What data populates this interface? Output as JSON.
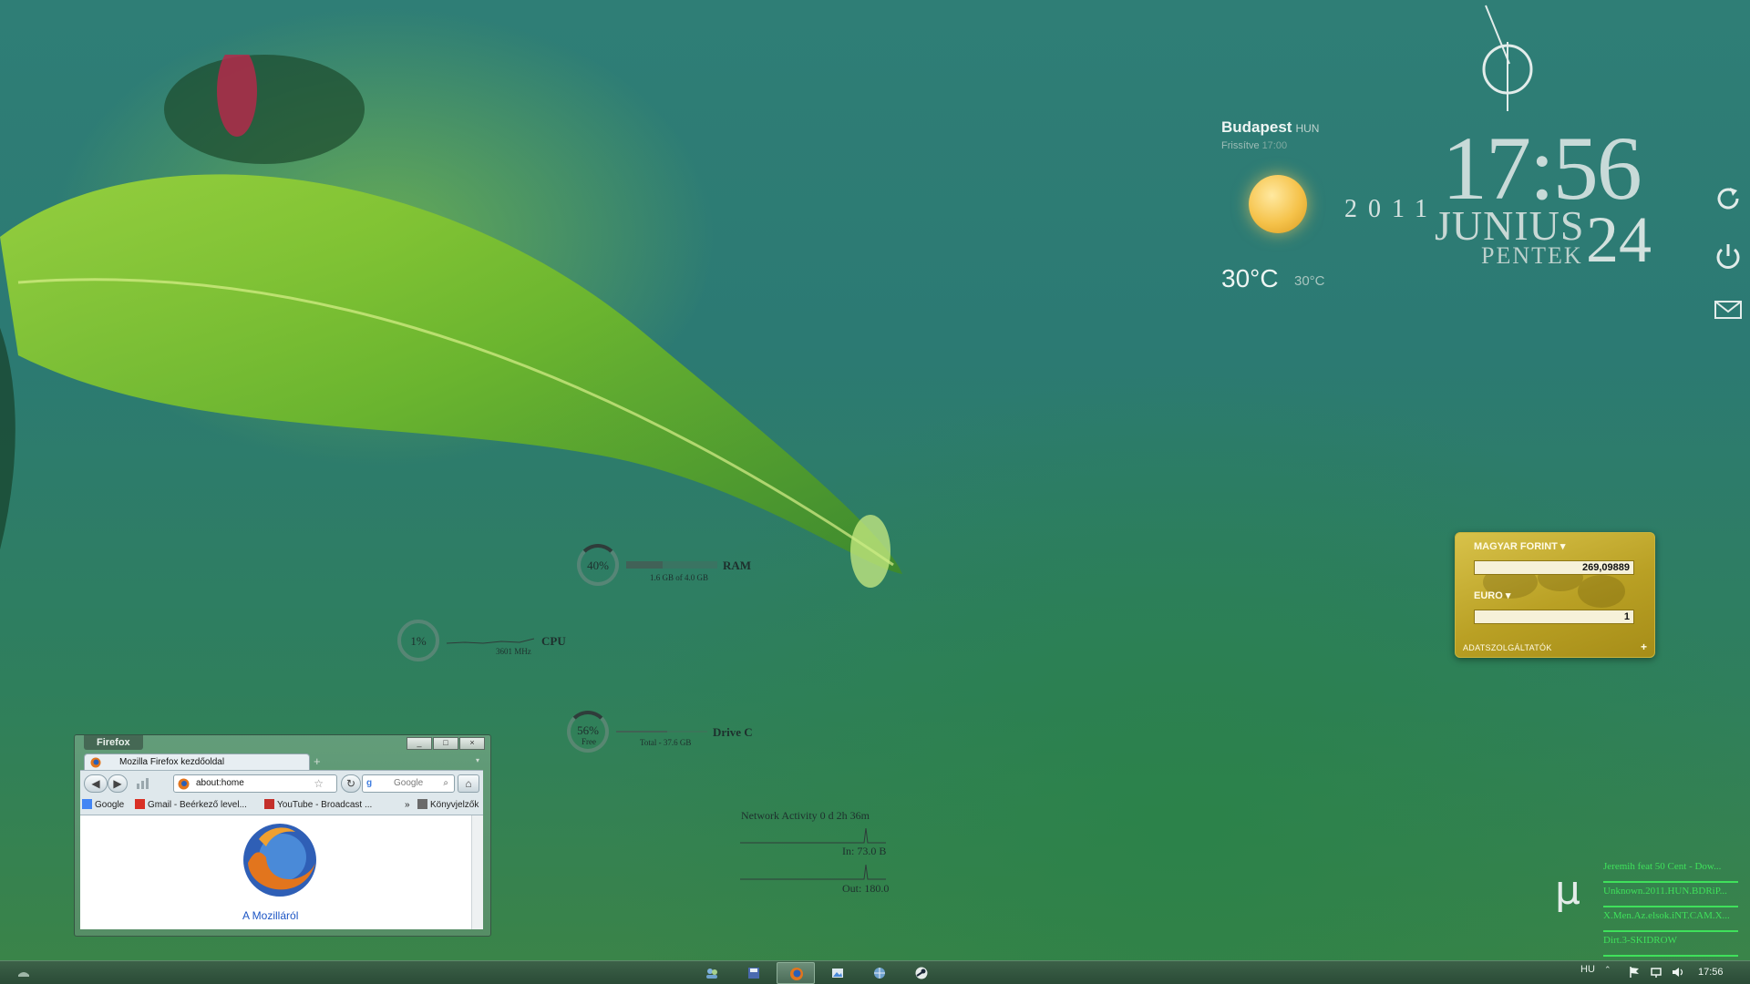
{
  "weather": {
    "city": "Budapest",
    "country": "HUN",
    "updated_label": "Frissítve",
    "updated_time": "17:00",
    "temperature": "30°C",
    "feels_like": "30°C",
    "condition_icon": "sun-icon"
  },
  "clock": {
    "time": "17:56",
    "year": "2011",
    "month": "JUNIUS",
    "day": "24",
    "weekday": "PENTEK"
  },
  "side_icons": [
    "refresh-icon",
    "power-icon",
    "mail-icon"
  ],
  "meters": {
    "ram": {
      "percent": "40%",
      "value": 0.4,
      "label": "RAM",
      "detail": "1.6 GB of 4.0 GB"
    },
    "cpu": {
      "percent": "1%",
      "value": 0.01,
      "label": "CPU",
      "detail": "3601 MHz"
    },
    "drive": {
      "percent": "56%",
      "sub": "Free",
      "value": 0.56,
      "label": "Drive C",
      "detail": "Total - 37.6 GB"
    }
  },
  "network": {
    "title": "Network Activity",
    "uptime": "0 d 2h 36m",
    "in": "In: 73.0 B",
    "out": "Out: 180.0"
  },
  "currency": {
    "from_name": "MAGYAR FORINT",
    "from_value": "269,09889",
    "to_name": "EURO",
    "to_value": "1",
    "providers": "ADATSZOLGÁLTATÓK",
    "add": "+"
  },
  "firefox": {
    "app_title": "Firefox",
    "tab_title": "Mozilla Firefox kezdőoldal",
    "new_tab": "+",
    "url": "about:home",
    "search_placeholder": "Google",
    "bookmarks": [
      "Google",
      "Gmail - Beérkező level...",
      "YouTube - Broadcast ...",
      "Könyvjelzők"
    ],
    "bookmarks_more": "»",
    "about_link": "A Mozilláról",
    "window_buttons": [
      "_",
      "□",
      "×"
    ]
  },
  "utorrent": {
    "items": [
      "Jeremih feat 50 Cent - Dow...",
      "Unknown.2011.HUN.BDRiP...",
      "X.Men.Az.elsok.iNT.CAM.X...",
      "Dirt.3-SKIDROW"
    ]
  },
  "taskbar": {
    "items": [
      "users-icon",
      "save-icon",
      "firefox-icon",
      "picture-icon",
      "globe-icon",
      "steam-icon"
    ],
    "active_index": 2,
    "language": "HU",
    "show_hidden": "⌃",
    "tray_icons": [
      "flag-icon",
      "network-icon",
      "volume-icon"
    ],
    "time": "17:56"
  },
  "colors": {
    "utorrent_green": "#3fe15b",
    "currency_gold": "#c4ab2c",
    "link_blue": "#1c55c4"
  }
}
